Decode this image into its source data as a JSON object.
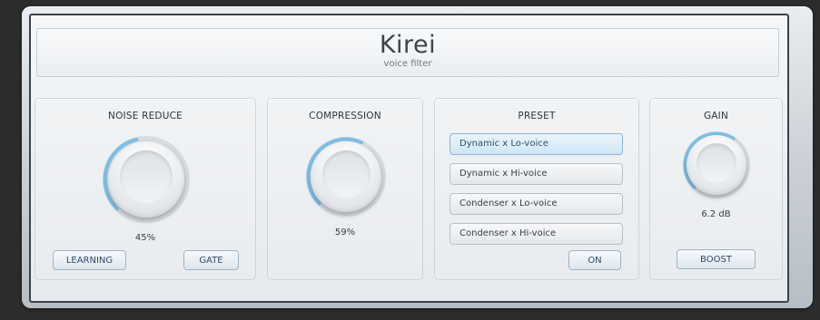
{
  "header": {
    "title": "Kirei",
    "subtitle": "voice filter"
  },
  "noise_reduce": {
    "title": "NOISE REDUCE",
    "value": 0.45,
    "value_label": "45%",
    "buttons": {
      "learning": "LEARNING",
      "gate": "GATE"
    }
  },
  "compression": {
    "title": "COMPRESSION",
    "value": 0.59,
    "value_label": "59%"
  },
  "preset": {
    "title": "PRESET",
    "items": [
      {
        "label": "Dynamic x Lo-voice",
        "selected": true
      },
      {
        "label": "Dynamic x Hi-voice",
        "selected": false
      },
      {
        "label": "Condenser x Lo-voice",
        "selected": false
      },
      {
        "label": "Condenser x Hi-voice",
        "selected": false
      }
    ],
    "on_label": "ON"
  },
  "gain": {
    "title": "GAIN",
    "value": 0.62,
    "value_label": "6.2 dB",
    "boost_label": "BOOST"
  },
  "colors": {
    "accent": "#7dc0e6",
    "button_text": "#2f4a66",
    "selected_preset": "#cfe6f5"
  }
}
